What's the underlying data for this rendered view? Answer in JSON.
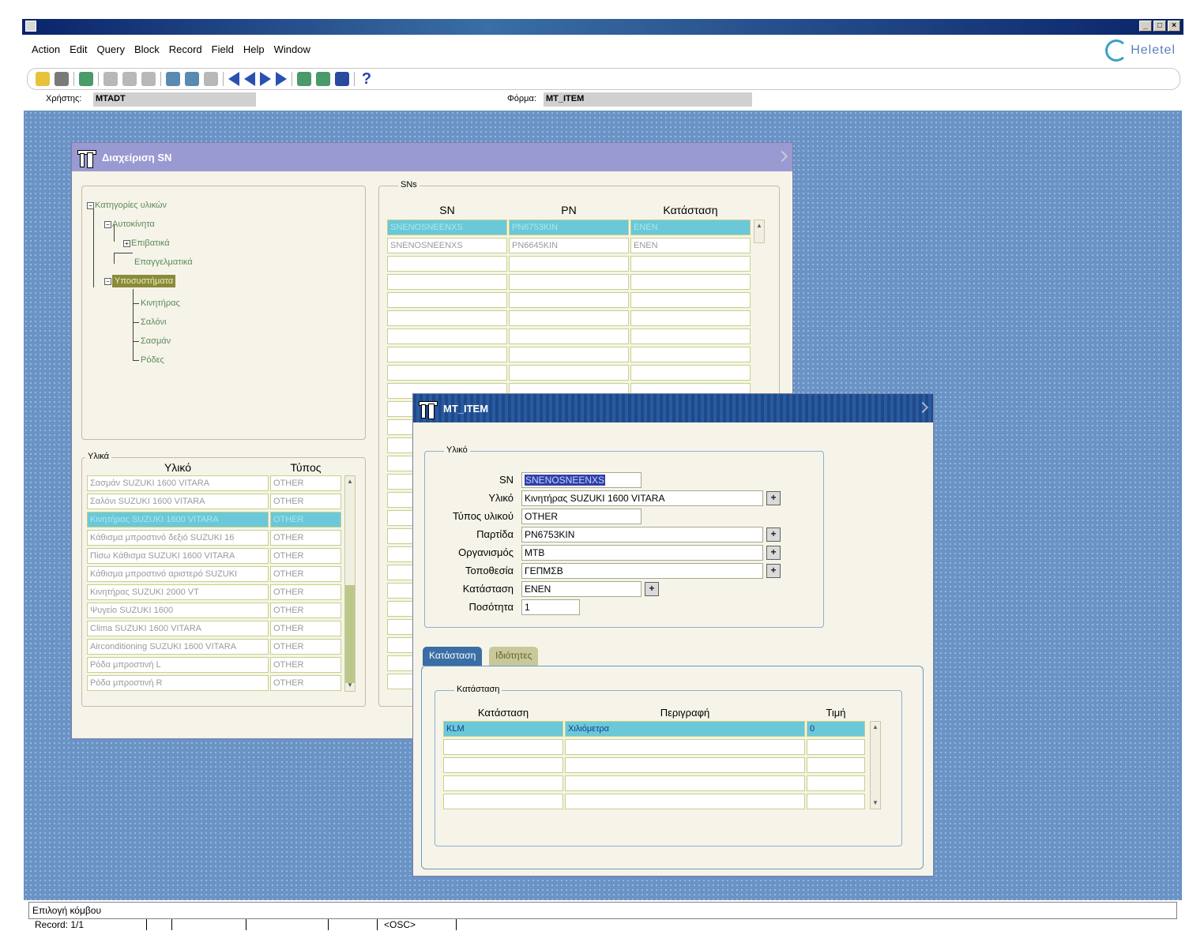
{
  "menu": [
    "Action",
    "Edit",
    "Query",
    "Block",
    "Record",
    "Field",
    "Help",
    "Window"
  ],
  "logo_text": "Heletel",
  "info": {
    "user_label": "Χρήστης:",
    "user_value": "MTADT",
    "form_label": "Φόρμα:",
    "form_value": "MT_ITEM"
  },
  "win_main": {
    "title": "Διαχείριση SN",
    "tree": [
      "Κατηγορίες υλικών",
      "Αυτοκίνητα",
      "Επιβατικά",
      "Επαγγελματικά",
      "Υποσυστήματα",
      "Κινητήρας",
      "Σαλόνι",
      "Σασμάν",
      "Ρόδες"
    ],
    "sn_group": "SNs",
    "sn_headers": [
      "SN",
      "PN",
      "Κατάσταση"
    ],
    "sn_rows": [
      [
        "SNENOSNEENXS",
        "PN6753KIN",
        "ENEN"
      ],
      [
        "SNENOSNEENXS",
        "PN6645KIN",
        "ENEN"
      ]
    ],
    "items_group": "Υλικά",
    "items_headers": [
      "Υλικό",
      "Τύπος"
    ],
    "items_rows": [
      [
        "Σασμάν SUZUKI 1600 VITARA",
        "OTHER"
      ],
      [
        "Σαλόνι SUZUKI 1600 VITARA",
        "OTHER"
      ],
      [
        "Κινητήρας SUZUKI 1600 VITARA",
        "OTHER"
      ],
      [
        "Κάθισμα μπροστινό δεξιό SUZUKI 16",
        "OTHER"
      ],
      [
        "Πίσω Κάθισμα SUZUKI 1600 VITARA",
        "OTHER"
      ],
      [
        "Κάθισμα μπροστινό αριστερό SUZUKI",
        "OTHER"
      ],
      [
        "Κινητήρας SUZUKI 2000 VT",
        "OTHER"
      ],
      [
        "Ψυγείο SUZUKI 1600",
        "OTHER"
      ],
      [
        "Clima SUZUKI 1600 VITARA",
        "OTHER"
      ],
      [
        "Airconditioning SUZUKI 1600 VITARA",
        "OTHER"
      ],
      [
        "Ρόδα μπροστινή L",
        "OTHER"
      ],
      [
        "Ρόδα μπροστινή R",
        "OTHER"
      ]
    ]
  },
  "win_item": {
    "title": "MT_ITEM",
    "group": "Υλικό",
    "labels": {
      "sn": "SN",
      "item": "Υλικό",
      "type": "Τύπος υλικού",
      "batch": "Παρτίδα",
      "org": "Οργανισμός",
      "loc": "Τοποθεσία",
      "status": "Κατάσταση",
      "qty": "Ποσότητα"
    },
    "values": {
      "sn": "SNENOSNEENXS",
      "item": "Κινητήρας SUZUKI 1600 VITARA",
      "type": "OTHER",
      "batch": "PN6753KIN",
      "org": "MTB",
      "loc": "ΓΕΠΜΣΒ",
      "status": "ENEN",
      "qty": "1"
    },
    "lov": "+",
    "tabs": [
      "Κατάσταση",
      "Ιδιότητες"
    ],
    "status_group": "Κατάσταση",
    "status_headers": [
      "Κατάσταση",
      "Περιγραφή",
      "Τιμή"
    ],
    "status_rows": [
      [
        "KLM",
        "Χιλιόμετρα",
        "0"
      ]
    ]
  },
  "status_bar": {
    "message": "Επιλογή κόμβου",
    "record": "Record: 1/1",
    "osc": "<OSC>"
  }
}
